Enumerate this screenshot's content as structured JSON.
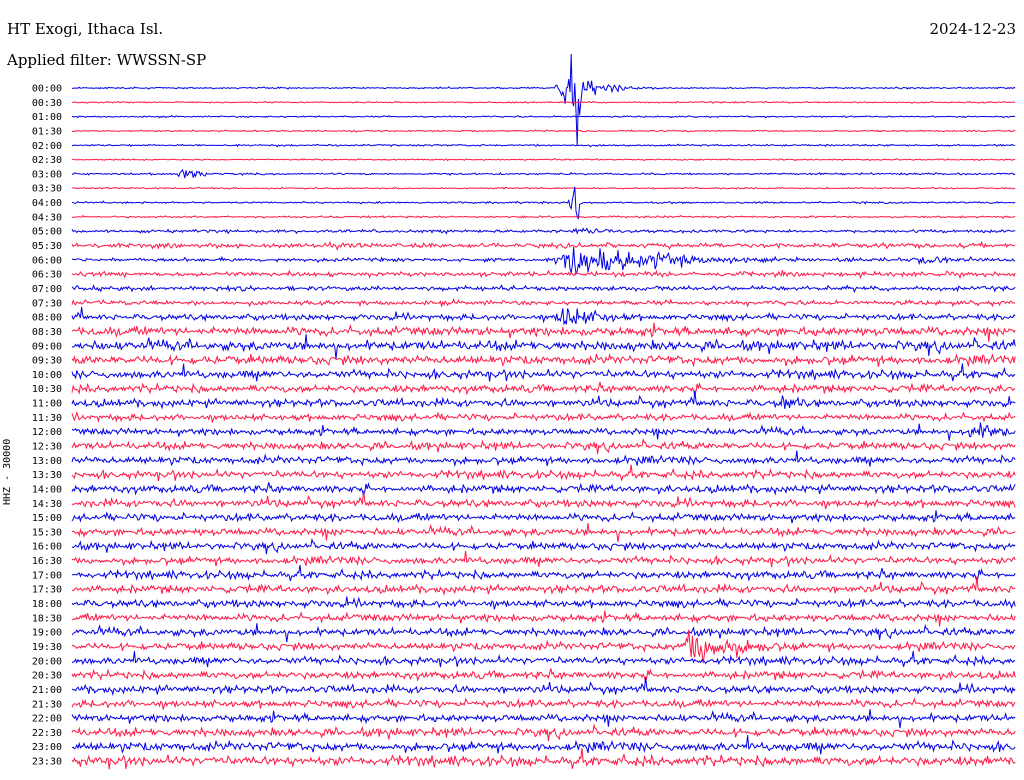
{
  "header": {
    "station": "HT Exogi, Ithaca Isl.",
    "filter": "Applied filter: WWSSN-SP",
    "date": "2024-12-23",
    "channel": "HHZ - 30000"
  },
  "colors": {
    "even_row": "#0000e6",
    "odd_row": "#ff1744"
  },
  "chart_data": {
    "type": "line",
    "title": "HT Exogi, Ithaca Isl.",
    "subtitle": "Applied filter: WWSSN-SP",
    "ylabel": "HHZ - 30000",
    "xlabel": "",
    "rows": [
      "00:00",
      "00:30",
      "01:00",
      "01:30",
      "02:00",
      "02:30",
      "03:00",
      "03:30",
      "04:00",
      "04:30",
      "05:00",
      "05:30",
      "06:00",
      "06:30",
      "07:00",
      "07:30",
      "08:00",
      "08:30",
      "09:00",
      "09:30",
      "10:00",
      "10:30",
      "11:00",
      "11:30",
      "12:00",
      "12:30",
      "13:00",
      "13:30",
      "14:00",
      "14:30",
      "15:00",
      "15:30",
      "16:00",
      "16:30",
      "17:00",
      "17:30",
      "18:00",
      "18:30",
      "19:00",
      "19:30",
      "20:00",
      "20:30",
      "21:00",
      "21:30",
      "22:00",
      "22:30",
      "23:00",
      "23:30"
    ],
    "noise_amplitude": [
      0.2,
      0.2,
      0.2,
      0.2,
      0.25,
      0.2,
      0.25,
      0.2,
      0.25,
      0.25,
      0.4,
      0.6,
      0.5,
      0.6,
      0.6,
      0.6,
      0.8,
      1.2,
      1.3,
      1.2,
      1.1,
      1.0,
      1.0,
      0.9,
      0.9,
      1.0,
      1.0,
      1.0,
      1.0,
      1.0,
      1.0,
      1.0,
      1.0,
      1.0,
      1.0,
      1.0,
      1.0,
      1.0,
      1.0,
      1.0,
      1.0,
      1.0,
      1.0,
      1.0,
      1.0,
      1.1,
      1.2,
      1.3
    ],
    "events": [
      {
        "row": "00:00",
        "minute": 15.5,
        "amplitude": 18,
        "duration_min": 3
      },
      {
        "row": "03:00",
        "minute": 3.5,
        "amplitude": 9,
        "duration_min": 1.5
      },
      {
        "row": "05:00",
        "minute": 16,
        "amplitude": 5,
        "duration_min": 2
      },
      {
        "row": "06:00",
        "minute": 27,
        "amplitude": 8,
        "duration_min": 2
      },
      {
        "row": "06:00",
        "minute": 15.5,
        "amplitude": 20,
        "duration_min": 8
      },
      {
        "row": "08:00",
        "minute": 15.5,
        "amplitude": 14,
        "duration_min": 4
      },
      {
        "row": "11:00",
        "minute": 22.5,
        "amplitude": 10,
        "duration_min": 2
      },
      {
        "row": "12:00",
        "minute": 28.5,
        "amplitude": 12,
        "duration_min": 3
      },
      {
        "row": "19:30",
        "minute": 19.5,
        "amplitude": 22,
        "duration_min": 5
      }
    ],
    "spikes": [
      {
        "row": "00:00",
        "minute": 16.0,
        "amplitude": 85
      },
      {
        "row": "04:00",
        "minute": 16.0,
        "amplitude": 30
      },
      {
        "row": "19:30",
        "minute": 20.0,
        "amplitude": 20
      }
    ]
  }
}
